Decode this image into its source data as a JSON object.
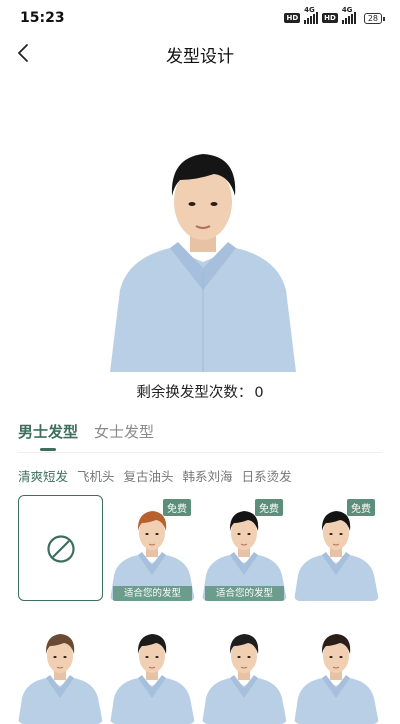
{
  "status": {
    "time": "15:23",
    "hd1": "HD",
    "net1": "4G",
    "hd2": "HD",
    "net2": "4G",
    "battery": "28"
  },
  "nav": {
    "title": "发型设计"
  },
  "preview": {
    "remaining_label": "剩余换发型次数：",
    "remaining_count": "0"
  },
  "gender_tabs": [
    {
      "label": "男士发型",
      "active": true
    },
    {
      "label": "女士发型",
      "active": false
    }
  ],
  "style_tabs": [
    {
      "label": "清爽短发",
      "active": true
    },
    {
      "label": "飞机头",
      "active": false
    },
    {
      "label": "复古油头",
      "active": false
    },
    {
      "label": "韩系刘海",
      "active": false
    },
    {
      "label": "日系烫发",
      "active": false
    }
  ],
  "cards": [
    {
      "type": "none"
    },
    {
      "badge": "免费",
      "fit_label": "适合您的发型",
      "hair": "#b8612e"
    },
    {
      "badge": "免费",
      "fit_label": "适合您的发型",
      "hair": "#141414"
    },
    {
      "badge": "免费",
      "hair": "#141414"
    },
    {
      "hair": "#6b4a33"
    },
    {
      "hair": "#1b1b1b"
    },
    {
      "hair": "#1e1e1e"
    },
    {
      "hair": "#2b1d18"
    }
  ],
  "colors": {
    "accent": "#3e6f5e",
    "badge": "#5b8f7c",
    "shirt": "#b9cfe6"
  }
}
